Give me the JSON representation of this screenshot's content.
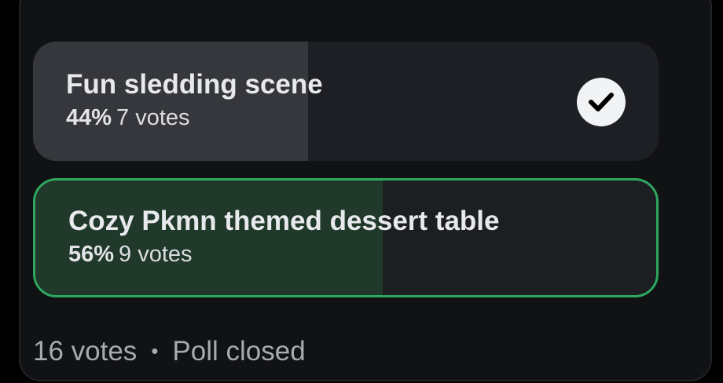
{
  "poll": {
    "options": [
      {
        "label": "Fun sledding scene",
        "percent": "44%",
        "votes": "7 votes",
        "fill_fraction": 0.44,
        "selected": true,
        "check_icon": "check-circle-icon"
      },
      {
        "label": "Cozy Pkmn themed dessert table",
        "percent": "56%",
        "votes": "9 votes",
        "fill_fraction": 0.56,
        "selected": false,
        "winner": true
      }
    ],
    "footer": {
      "total_votes": "16 votes",
      "separator": "•",
      "status": "Poll closed"
    },
    "colors": {
      "card_bg": "#111214",
      "option_bg": "#1e1f24",
      "selected_fill": "#36373d",
      "winner_border": "#2ea760",
      "winner_fill": "#20392b",
      "text": "#e8e9ec",
      "muted_text": "#a8aab1"
    }
  }
}
